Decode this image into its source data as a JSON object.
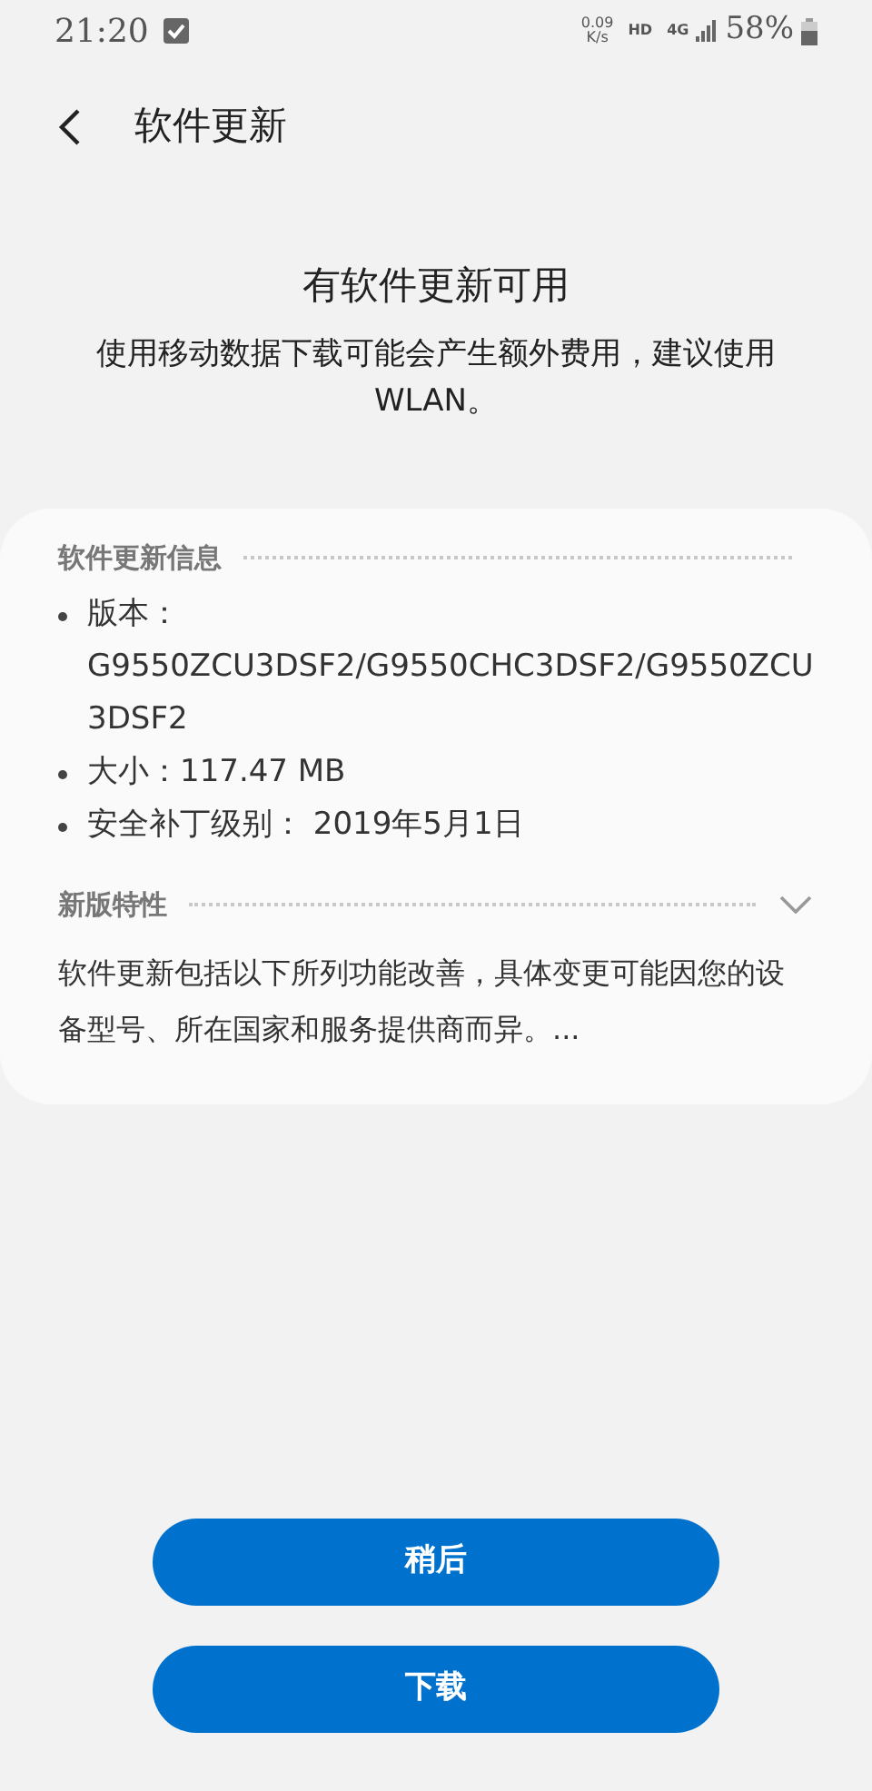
{
  "status_bar": {
    "time": "21:20",
    "net_speed": "0.09",
    "net_unit": "K/s",
    "hd": "HD",
    "network": "4G",
    "battery": "58%"
  },
  "header": {
    "title": "软件更新"
  },
  "notice": {
    "title": "有软件更新可用",
    "message": "使用移动数据下载可能会产生额外费用，建议使用 WLAN。"
  },
  "card": {
    "info_heading": "软件更新信息",
    "info_items": [
      "版本：G9550ZCU3DSF2/G9550CHC3DSF2/G9550ZCU3DSF2",
      "大小：117.47 MB",
      "安全补丁级别： 2019年5月1日"
    ],
    "features_heading": "新版特性",
    "features_expanded": false,
    "features_text": "软件更新包括以下所列功能改善，具体变更可能因您的设备型号、所在国家和服务提供商而异。..."
  },
  "buttons": [
    "稍后",
    "下载"
  ]
}
